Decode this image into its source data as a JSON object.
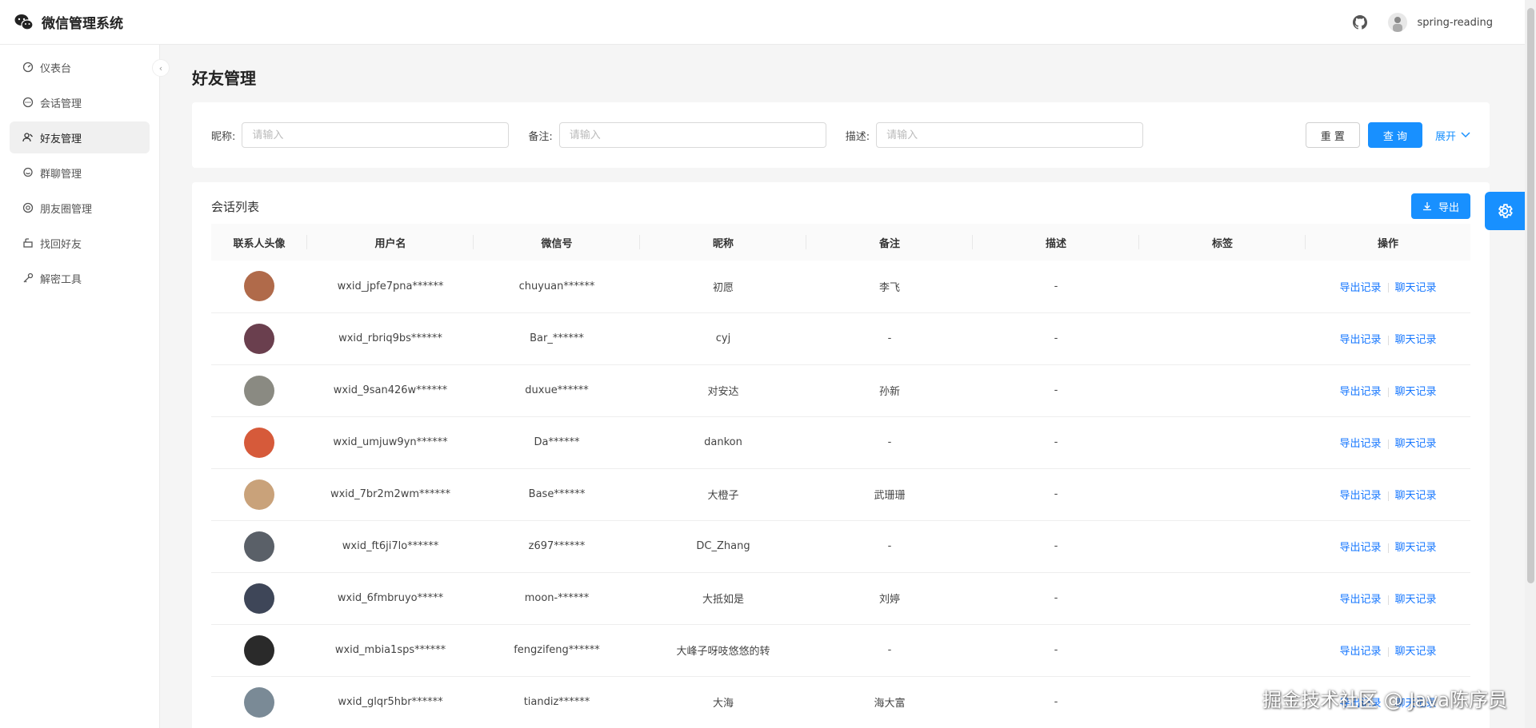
{
  "app": {
    "title": "微信管理系统",
    "username": "spring-reading"
  },
  "sidebar": {
    "items": [
      {
        "label": "仪表台",
        "icon": "dashboard-icon",
        "active": false
      },
      {
        "label": "会话管理",
        "icon": "chat-icon",
        "active": false
      },
      {
        "label": "好友管理",
        "icon": "contacts-icon",
        "active": true
      },
      {
        "label": "群聊管理",
        "icon": "group-chat-icon",
        "active": false
      },
      {
        "label": "朋友圈管理",
        "icon": "moments-icon",
        "active": false
      },
      {
        "label": "找回好友",
        "icon": "recover-icon",
        "active": false
      },
      {
        "label": "解密工具",
        "icon": "key-icon",
        "active": false
      }
    ]
  },
  "page": {
    "title": "好友管理"
  },
  "filter": {
    "nickname_label": "昵称:",
    "remark_label": "备注:",
    "desc_label": "描述:",
    "placeholder": "请输入",
    "reset_label": "重 置",
    "query_label": "查 询",
    "expand_label": "展开"
  },
  "list": {
    "title": "会话列表",
    "export_label": "导出",
    "columns": [
      "联系人头像",
      "用户名",
      "微信号",
      "昵称",
      "备注",
      "描述",
      "标签",
      "操作"
    ],
    "op_export": "导出记录",
    "op_chat": "聊天记录",
    "rows": [
      {
        "username": "wxid_jpfe7pna******",
        "wechat": "chuyuan******",
        "nickname": "初愿",
        "remark": "李飞",
        "desc": "-",
        "tag": "",
        "color": "#b06a4a"
      },
      {
        "username": "wxid_rbriq9bs******",
        "wechat": "Bar_******",
        "nickname": "cyj",
        "remark": "-",
        "desc": "-",
        "tag": "",
        "color": "#6a3f4e"
      },
      {
        "username": "wxid_9san426w******",
        "wechat": "duxue******",
        "nickname": "对安达",
        "remark": "孙新",
        "desc": "-",
        "tag": "",
        "color": "#8a8a82"
      },
      {
        "username": "wxid_umjuw9yn******",
        "wechat": "Da******",
        "nickname": "dankon",
        "remark": "-",
        "desc": "-",
        "tag": "",
        "color": "#d65a3a"
      },
      {
        "username": "wxid_7br2m2wm******",
        "wechat": "Base******",
        "nickname": "大橙子",
        "remark": "武珊珊",
        "desc": "-",
        "tag": "",
        "color": "#c9a27a"
      },
      {
        "username": "wxid_ft6ji7lo******",
        "wechat": "z697******",
        "nickname": "DC_Zhang",
        "remark": "-",
        "desc": "-",
        "tag": "",
        "color": "#5a6068"
      },
      {
        "username": "wxid_6fmbruyo*****",
        "wechat": "moon-******",
        "nickname": "大抵如是",
        "remark": "刘婷",
        "desc": "-",
        "tag": "",
        "color": "#3e4658"
      },
      {
        "username": "wxid_mbia1sps******",
        "wechat": "fengzifeng******",
        "nickname": "大峰子呀吱悠悠的转",
        "remark": "-",
        "desc": "-",
        "tag": "",
        "color": "#2a2a2a"
      },
      {
        "username": "wxid_glqr5hbr******",
        "wechat": "tiandiz******",
        "nickname": "大海",
        "remark": "海大富",
        "desc": "-",
        "tag": "",
        "color": "#7a8a96"
      }
    ]
  },
  "watermark": "掘金技术社区 @ Java陈序员"
}
